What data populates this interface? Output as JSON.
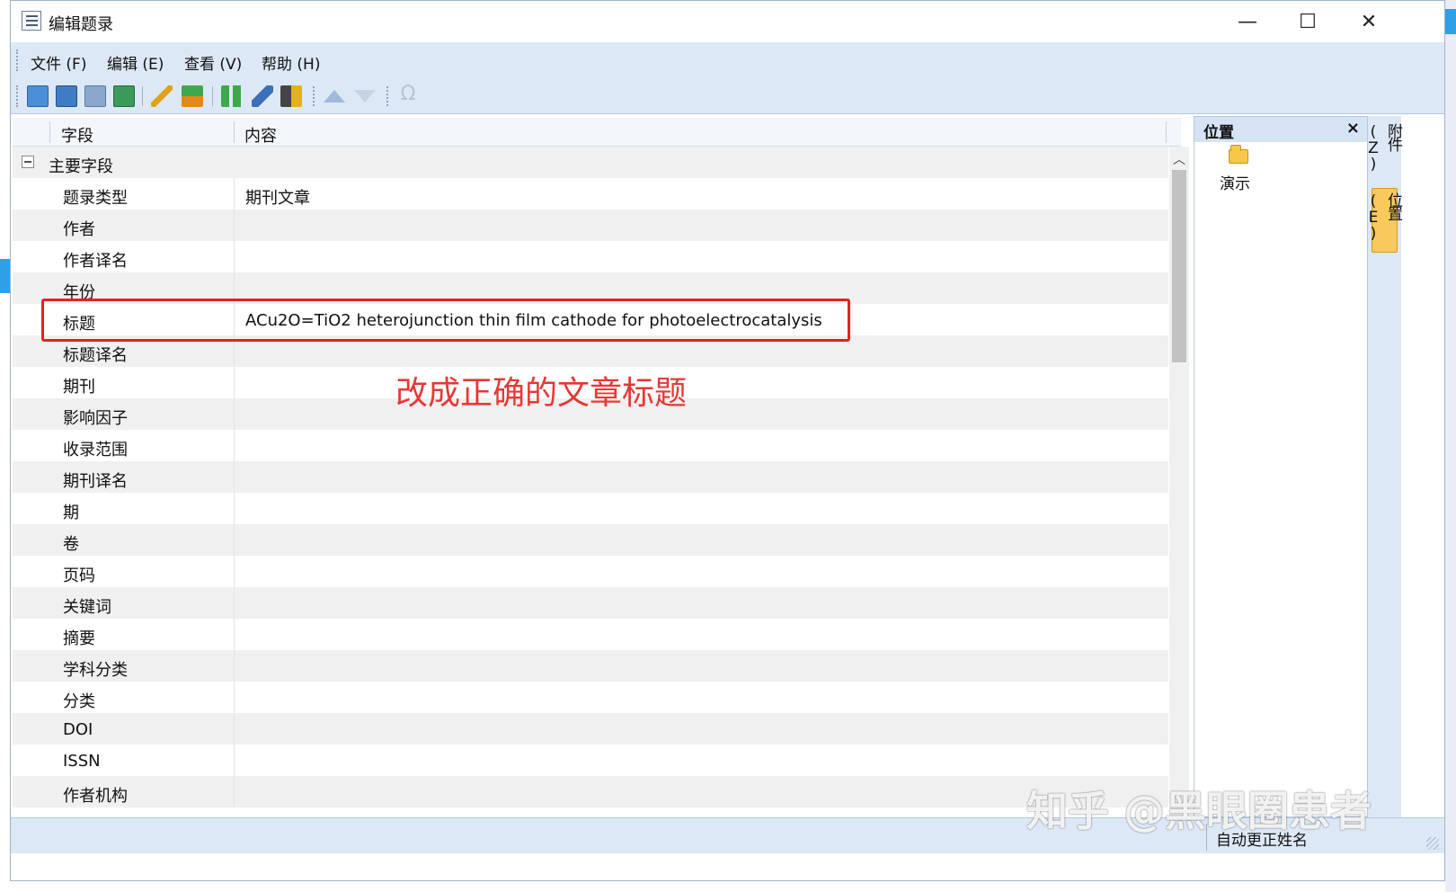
{
  "window": {
    "title": "编辑题录",
    "controls": {
      "minimize": "—",
      "maximize": "☐",
      "close": "✕"
    }
  },
  "menu": [
    "文件 (F)",
    "编辑 (E)",
    "查看 (V)",
    "帮助 (H)"
  ],
  "grid": {
    "headers": {
      "field": "字段",
      "content": "内容"
    },
    "group": "主要字段",
    "rows": [
      {
        "field": "题录类型",
        "value": "期刊文章"
      },
      {
        "field": "作者",
        "value": ""
      },
      {
        "field": "作者译名",
        "value": ""
      },
      {
        "field": "年份",
        "value": ""
      },
      {
        "field": "标题",
        "value": "ACu2O=TiO2 heterojunction thin film cathode for photoelectrocatalysis"
      },
      {
        "field": "标题译名",
        "value": ""
      },
      {
        "field": "期刊",
        "value": ""
      },
      {
        "field": "影响因子",
        "value": ""
      },
      {
        "field": "收录范围",
        "value": ""
      },
      {
        "field": "期刊译名",
        "value": ""
      },
      {
        "field": "期",
        "value": ""
      },
      {
        "field": "卷",
        "value": ""
      },
      {
        "field": "页码",
        "value": ""
      },
      {
        "field": "关键词",
        "value": ""
      },
      {
        "field": "摘要",
        "value": ""
      },
      {
        "field": "学科分类",
        "value": ""
      },
      {
        "field": "分类",
        "value": ""
      },
      {
        "field": "DOI",
        "value": ""
      },
      {
        "field": "ISSN",
        "value": ""
      },
      {
        "field": "作者机构",
        "value": ""
      }
    ]
  },
  "annotation": "改成正确的文章标题",
  "side_panel": {
    "title": "位置",
    "close": "×",
    "item": "演示"
  },
  "side_tabs": [
    "附件(Z)",
    "位置(E)"
  ],
  "status": {
    "text": "自动更正姓名"
  },
  "watermark": "知乎 @黑眼圈患者"
}
